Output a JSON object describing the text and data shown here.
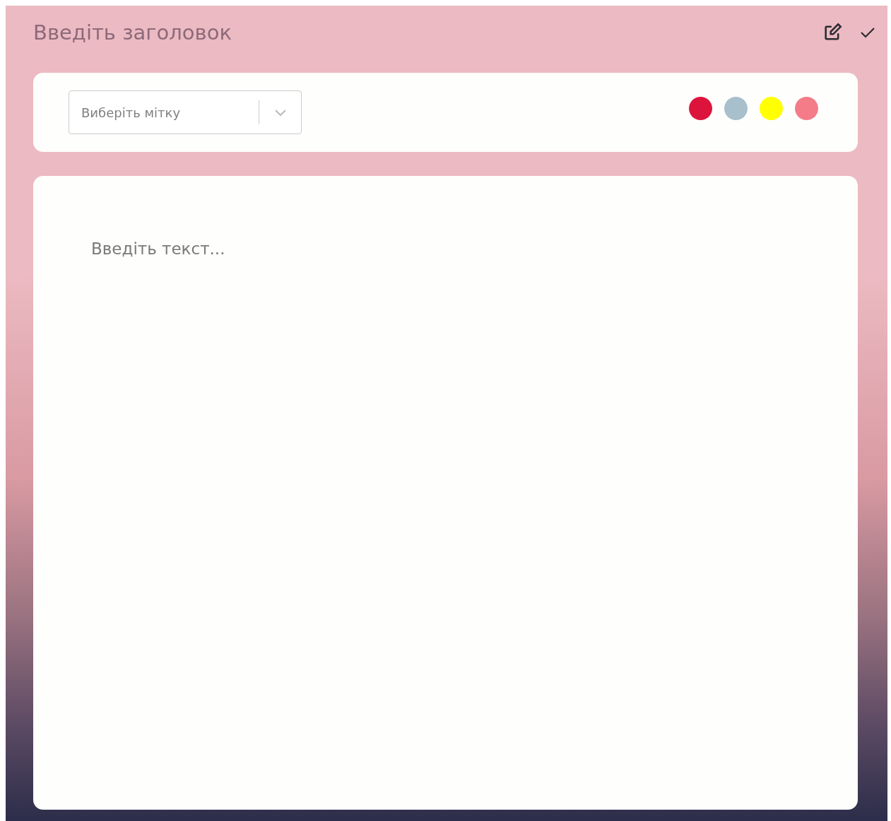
{
  "title": {
    "placeholder": "Введіть заголовок"
  },
  "label_select": {
    "placeholder": "Виберіть мітку"
  },
  "colors": [
    {
      "color": "#dc143c"
    },
    {
      "color": "#a8bfcc"
    },
    {
      "color": "#ffff00"
    },
    {
      "color": "#f47c88"
    }
  ],
  "body": {
    "placeholder": "Введіть текст..."
  }
}
